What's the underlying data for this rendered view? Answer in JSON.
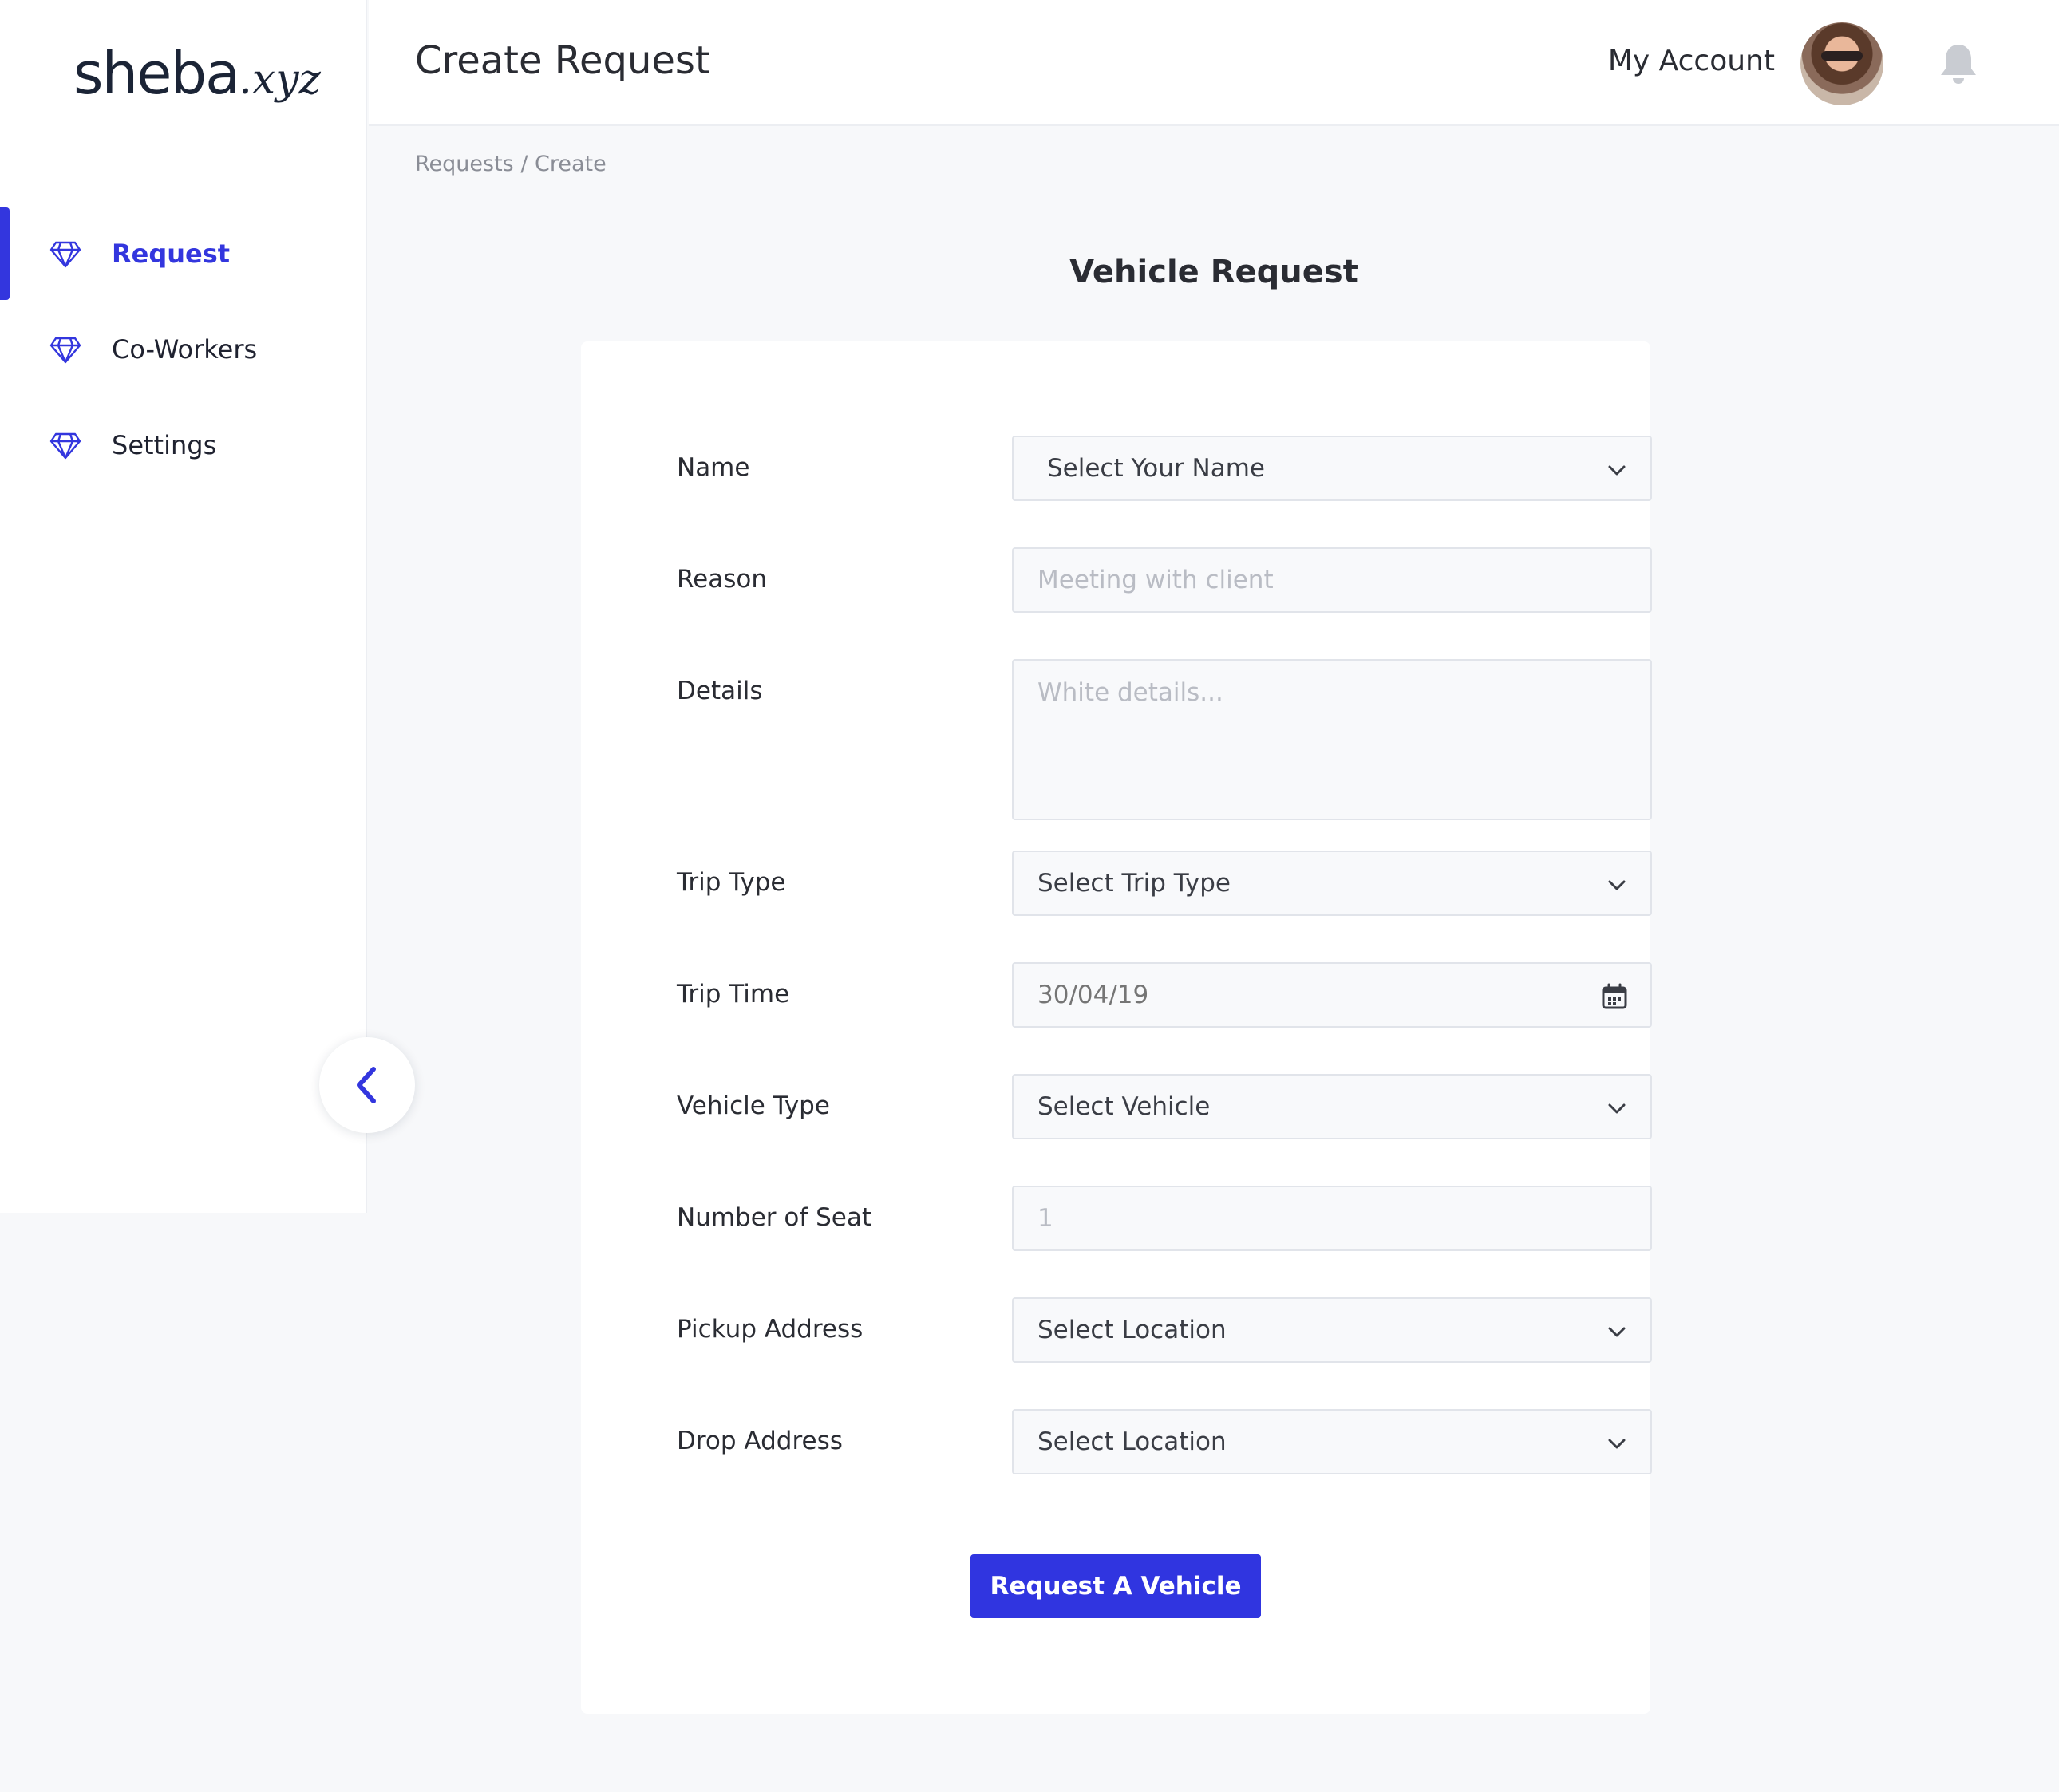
{
  "logo": {
    "main": "sheba",
    "suffix": ".xyz"
  },
  "sidebar": {
    "items": [
      {
        "label": "Request",
        "icon": "diamond-icon",
        "active": true
      },
      {
        "label": "Co-Workers",
        "icon": "diamond-icon",
        "active": false
      },
      {
        "label": "Settings",
        "icon": "diamond-icon",
        "active": false
      }
    ],
    "collapse_icon": "chevron-left-icon"
  },
  "header": {
    "title": "Create Request",
    "account_label": "My Account",
    "notification_icon": "bell-icon"
  },
  "breadcrumb": "Requests / Create",
  "form": {
    "title": "Vehicle Request",
    "fields": {
      "name": {
        "label": "Name",
        "value": "Select Your Name"
      },
      "reason": {
        "label": "Reason",
        "placeholder": "Meeting with client"
      },
      "details": {
        "label": "Details",
        "placeholder": "White details..."
      },
      "trip_type": {
        "label": "Trip Type",
        "value": "Select Trip Type"
      },
      "trip_time": {
        "label": "Trip Time",
        "placeholder": "30/04/19"
      },
      "vehicle_type": {
        "label": "Vehicle Type",
        "value": "Select Vehicle"
      },
      "seats": {
        "label": "Number of Seat",
        "placeholder": "1"
      },
      "pickup": {
        "label": "Pickup Address",
        "value": "Select Location"
      },
      "drop": {
        "label": "Drop Address",
        "value": "Select Location"
      }
    },
    "submit_label": "Request A Vehicle"
  },
  "colors": {
    "accent": "#3336de",
    "button": "#3035e0",
    "background": "#f7f8fa",
    "field_border": "#e1e4ea"
  }
}
